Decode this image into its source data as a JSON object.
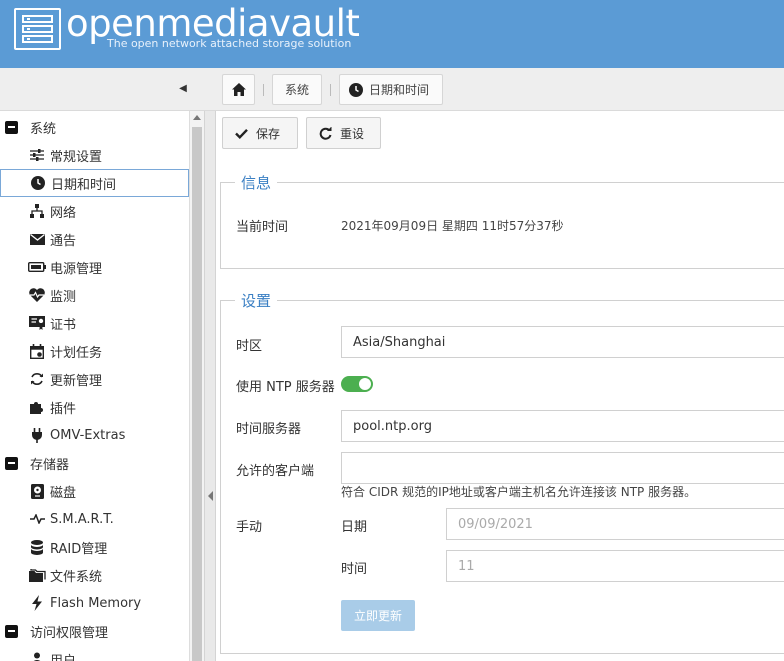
{
  "header": {
    "title": "openmediavault",
    "subtitle": "The open network attached storage solution"
  },
  "breadcrumb": {
    "home_icon": "home-icon",
    "items": [
      "系统",
      "日期和时间"
    ]
  },
  "sidebar": {
    "items": [
      {
        "label": "系统",
        "icon": "minus-box",
        "type": "group"
      },
      {
        "label": "常规设置",
        "icon": "sliders-icon",
        "type": "child"
      },
      {
        "label": "日期和时间",
        "icon": "clock-icon",
        "type": "child",
        "selected": true
      },
      {
        "label": "网络",
        "icon": "network-icon",
        "type": "child"
      },
      {
        "label": "通告",
        "icon": "envelope-icon",
        "type": "child"
      },
      {
        "label": "电源管理",
        "icon": "battery-icon",
        "type": "child"
      },
      {
        "label": "监测",
        "icon": "heartbeat-icon",
        "type": "child"
      },
      {
        "label": "证书",
        "icon": "certificate-icon",
        "type": "child"
      },
      {
        "label": "计划任务",
        "icon": "calendar-icon",
        "type": "child"
      },
      {
        "label": "更新管理",
        "icon": "refresh-icon",
        "type": "child"
      },
      {
        "label": "插件",
        "icon": "puzzle-icon",
        "type": "child"
      },
      {
        "label": "OMV-Extras",
        "icon": "plug-icon",
        "type": "child"
      },
      {
        "label": "存储器",
        "icon": "minus-box",
        "type": "group"
      },
      {
        "label": "磁盘",
        "icon": "disk-icon",
        "type": "child"
      },
      {
        "label": "S.M.A.R.T.",
        "icon": "pulse-icon",
        "type": "child"
      },
      {
        "label": "RAID管理",
        "icon": "database-icon",
        "type": "child"
      },
      {
        "label": "文件系统",
        "icon": "folder-icon",
        "type": "child"
      },
      {
        "label": "Flash Memory",
        "icon": "bolt-icon",
        "type": "child"
      },
      {
        "label": "访问权限管理",
        "icon": "minus-box",
        "type": "group"
      },
      {
        "label": "用户",
        "icon": "user-icon",
        "type": "child"
      }
    ]
  },
  "toolbar": {
    "save_label": "保存",
    "reset_label": "重设"
  },
  "info": {
    "legend": "信息",
    "current_time_label": "当前时间",
    "current_time_value": "2021年09月09日 星期四 11时57分37秒"
  },
  "settings": {
    "legend": "设置",
    "timezone_label": "时区",
    "timezone_value": "Asia/Shanghai",
    "ntp_label": "使用 NTP 服务器",
    "ntp_enabled": true,
    "time_server_label": "时间服务器",
    "time_server_value": "pool.ntp.org",
    "allowed_clients_label": "允许的客户端",
    "allowed_clients_value": "",
    "allowed_clients_help": "符合 CIDR 规范的IP地址或客户端主机名允许连接该 NTP 服务器。",
    "manual_label": "手动",
    "date_label": "日期",
    "date_value": "09/09/2021",
    "time_label": "时间",
    "time_value": "11",
    "update_now_label": "立即更新"
  },
  "colors": {
    "header_bg": "#5b9bd5",
    "legend_text": "#3a7fc3",
    "toggle_on": "#4caf50",
    "update_button_disabled": "#a9cce8"
  }
}
